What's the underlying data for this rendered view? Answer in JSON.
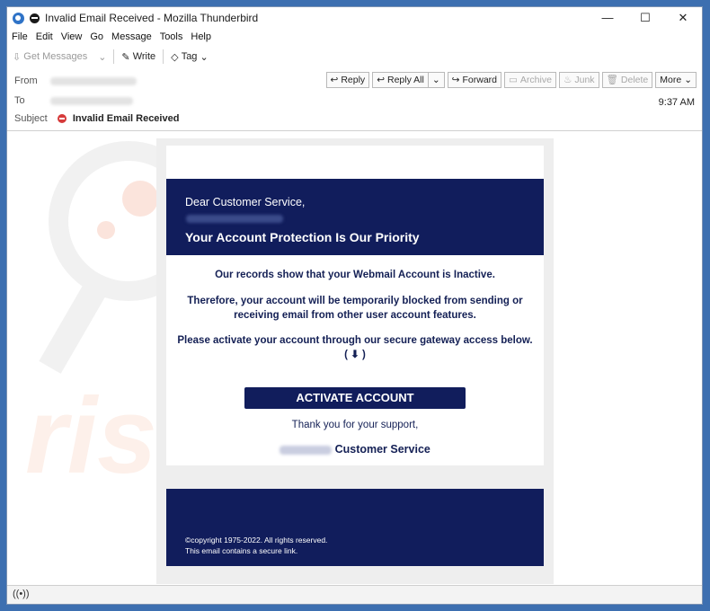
{
  "window": {
    "title": "Invalid Email Received - Mozilla Thunderbird",
    "controls": [
      "—",
      "☐",
      "✕"
    ]
  },
  "menu": [
    "File",
    "Edit",
    "View",
    "Go",
    "Message",
    "Tools",
    "Help"
  ],
  "toolbar": {
    "get_messages": "Get Messages",
    "write": "Write",
    "tag": "Tag"
  },
  "header": {
    "from_label": "From",
    "to_label": "To",
    "subject_label": "Subject",
    "subject": "Invalid Email Received",
    "time": "9:37 AM",
    "actions": {
      "reply": "Reply",
      "reply_all": "Reply All",
      "forward": "Forward",
      "archive": "Archive",
      "junk": "Junk",
      "delete": "Delete",
      "more": "More"
    }
  },
  "email": {
    "greeting": "Dear Customer Service,",
    "heading": "Your Account Protection Is Our Priority",
    "line1": "Our records show that your Webmail Account is Inactive.",
    "line2a": "Therefore, your account will be temporarily blocked from sending or",
    "line2b": "receiving email from other user account features.",
    "line3": "Please activate your account through our secure gateway access below.",
    "line3_icon": "( ⬇ )",
    "button": "ACTIVATE ACCOUNT",
    "thanks": "Thank you for your support,",
    "signature": "Customer Service",
    "copyright": "©copyright 1975-2022. All rights reserved.",
    "secure_note": "This email contains a secure link."
  },
  "colors": {
    "email_navy": "#111d5c",
    "accent_red": "#d63b3b"
  }
}
